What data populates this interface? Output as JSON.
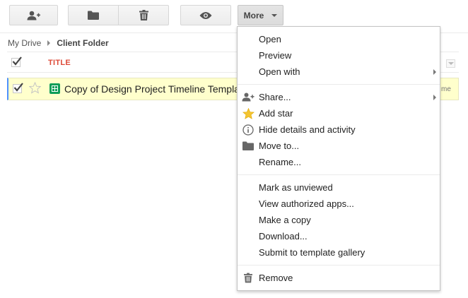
{
  "toolbar": {
    "new_share_icon": "person-add-icon",
    "folder_icon": "folder-icon",
    "trash_icon": "trash-icon",
    "preview_icon": "eye-icon",
    "more_label": "More"
  },
  "breadcrumb": {
    "root": "My Drive",
    "current": "Client Folder"
  },
  "list": {
    "title_header": "TITLE",
    "file": {
      "title": "Copy of Design Project Timeline Template",
      "owner_fragment": "me",
      "starred": false,
      "selected": true,
      "type_icon": "spreadsheet-icon"
    }
  },
  "menu": {
    "items": [
      {
        "label": "Open",
        "icon": "",
        "submenu": false
      },
      {
        "label": "Preview",
        "icon": "",
        "submenu": false
      },
      {
        "label": "Open with",
        "icon": "",
        "submenu": true
      },
      {
        "label": "Share...",
        "icon": "person-add-icon",
        "submenu": true
      },
      {
        "label": "Add star",
        "icon": "star-icon",
        "submenu": false
      },
      {
        "label": "Hide details and activity",
        "icon": "info-icon",
        "submenu": false
      },
      {
        "label": "Move to...",
        "icon": "folder-icon",
        "submenu": false
      },
      {
        "label": "Rename...",
        "icon": "",
        "submenu": false
      },
      {
        "label": "Mark as unviewed",
        "icon": "",
        "submenu": false
      },
      {
        "label": "View authorized apps...",
        "icon": "",
        "submenu": false
      },
      {
        "label": "Make a copy",
        "icon": "",
        "submenu": false
      },
      {
        "label": "Download...",
        "icon": "",
        "submenu": false
      },
      {
        "label": "Submit to template gallery",
        "icon": "",
        "submenu": false
      },
      {
        "label": "Remove",
        "icon": "trash-icon",
        "submenu": false
      }
    ]
  },
  "colors": {
    "title_header": "#dd4b39",
    "selected_row_bg": "#ffffcc",
    "selection_border": "#4d90fe",
    "star_fill": "#f4c430",
    "sheets_green": "#0f9d58"
  }
}
